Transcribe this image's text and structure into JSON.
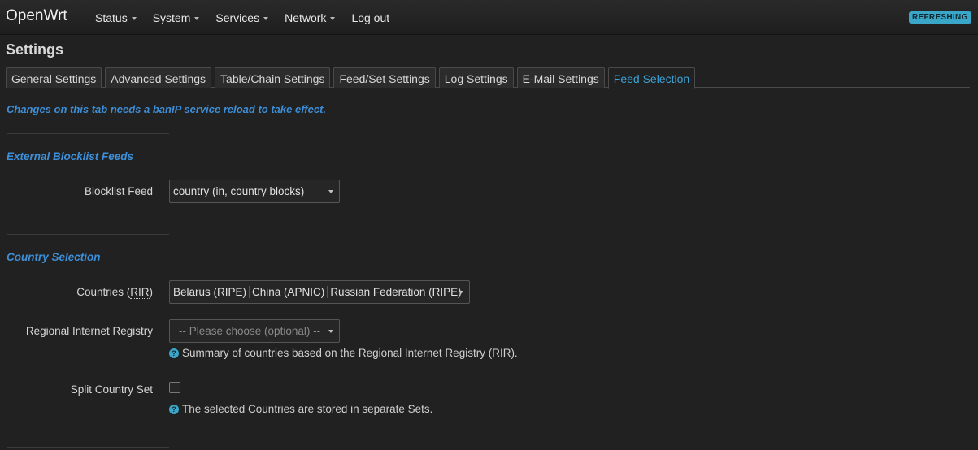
{
  "app": {
    "brand": "OpenWrt",
    "status_badge": "REFRESHING"
  },
  "menu": [
    {
      "label": "Status",
      "has_caret": true
    },
    {
      "label": "System",
      "has_caret": true
    },
    {
      "label": "Services",
      "has_caret": true
    },
    {
      "label": "Network",
      "has_caret": true
    },
    {
      "label": "Log out",
      "has_caret": false
    }
  ],
  "page": {
    "title": "Settings"
  },
  "tabs": [
    {
      "label": "General Settings",
      "active": false
    },
    {
      "label": "Advanced Settings",
      "active": false
    },
    {
      "label": "Table/Chain Settings",
      "active": false
    },
    {
      "label": "Feed/Set Settings",
      "active": false
    },
    {
      "label": "Log Settings",
      "active": false
    },
    {
      "label": "E-Mail Settings",
      "active": false
    },
    {
      "label": "Feed Selection",
      "active": true
    }
  ],
  "note": "Changes on this tab needs a banIP service reload to take effect.",
  "sections": {
    "external": {
      "title": "External Blocklist Feeds",
      "blocklist_feed": {
        "label": "Blocklist Feed",
        "value": "country (in, country blocks)"
      }
    },
    "country": {
      "title": "Country Selection",
      "countries": {
        "label_prefix": "Countries (",
        "label_abbr": "RIR",
        "label_suffix": ")",
        "selected": [
          "Belarus (RIPE)",
          "China (APNIC)",
          "Russian Federation (RIPE)"
        ]
      },
      "rir": {
        "label": "Regional Internet Registry",
        "placeholder": "-- Please choose (optional) --",
        "help": "Summary of countries based on the Regional Internet Registry (RIR)."
      },
      "split": {
        "label": "Split Country Set",
        "checked": false,
        "help": "The selected Countries are stored in separate Sets."
      }
    }
  },
  "colors": {
    "accent": "#3c8fd8",
    "badge": "#3aa7c9",
    "background": "#212121"
  },
  "icons": {
    "help": "question-circle-icon",
    "dropdown": "caret-down-icon"
  }
}
